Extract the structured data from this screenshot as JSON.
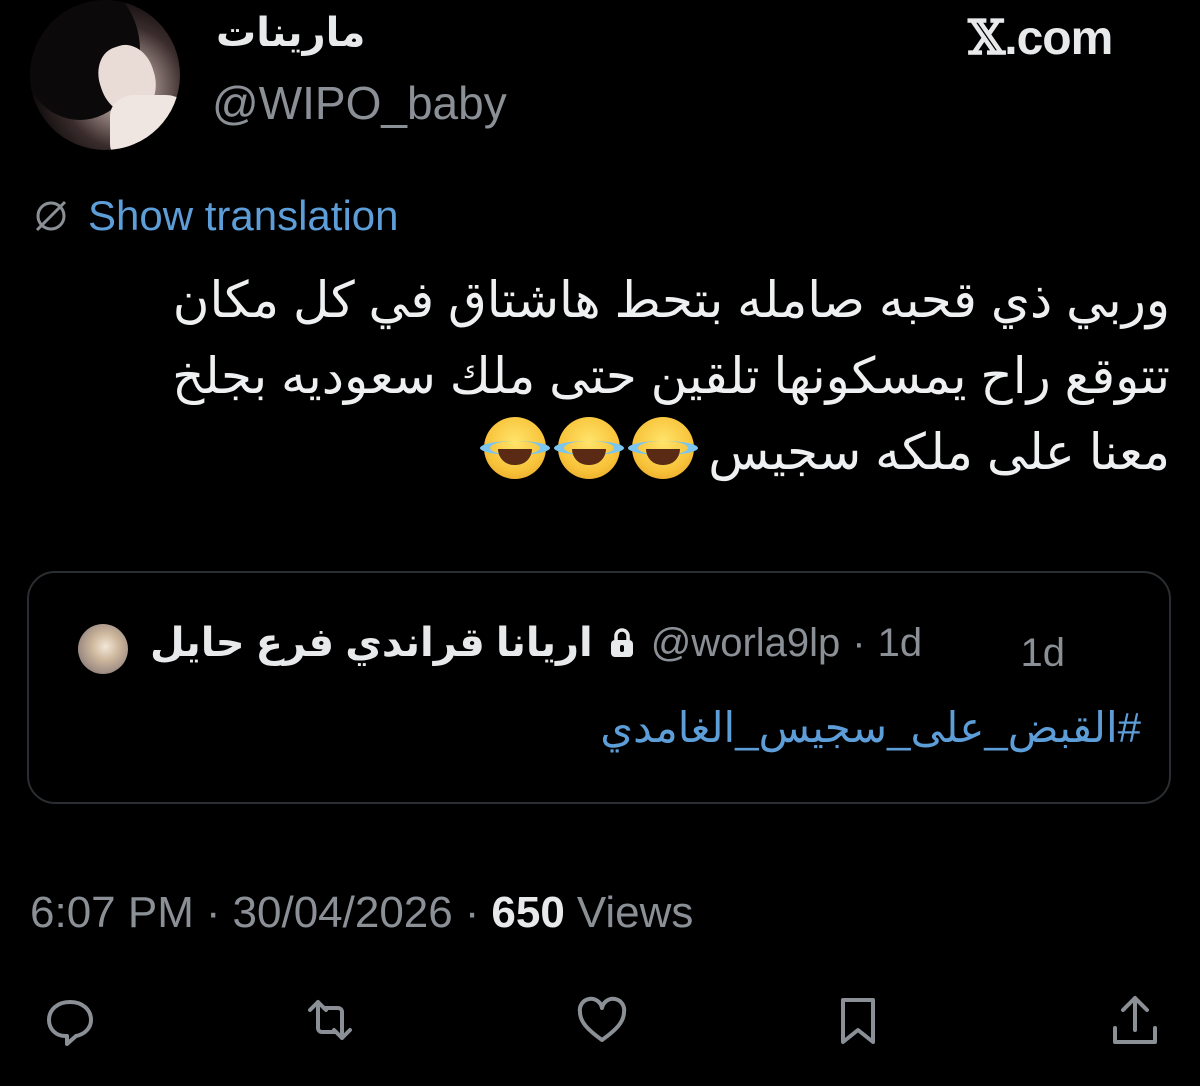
{
  "author": {
    "name": "مارينات",
    "handle": "@WIPO_baby"
  },
  "site_logo": ".com",
  "site_logo_x": "𝕏",
  "translation": {
    "label": "Show translation",
    "icon": "globe-slash-icon"
  },
  "tweet": {
    "lines": [
      "وربي ذي قحبه صامله بتحط هاشتاق في كل مكان",
      "تتوقع راح يمسكونها تلقين حتى ملك سعوديه بجلخ",
      "معنا على ملكه سجيس"
    ],
    "emoji": "face-with-tears-of-joy"
  },
  "quote": {
    "name": "اريانا قراندي فرع حايل",
    "handle": "@worla9lp",
    "separator": "·",
    "time": "1d",
    "hashtag": "#القبض_على_سجيس_الغامدي"
  },
  "meta": {
    "time": "6:07 PM",
    "separator": "·",
    "date": "30/04/2026",
    "views_count": "650",
    "views_label": "Views"
  },
  "actions": [
    "reply-icon",
    "retweet-icon",
    "like-icon",
    "bookmark-icon",
    "share-icon"
  ],
  "colors": {
    "background": "#000000",
    "link": "#5d9ed9",
    "muted": "#8b9096",
    "text": "#e7e9ea"
  }
}
